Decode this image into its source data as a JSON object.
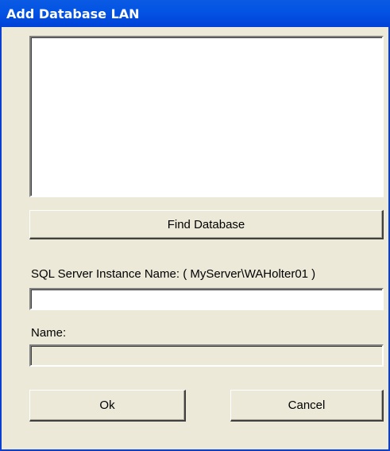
{
  "window": {
    "title": "Add Database LAN"
  },
  "buttons": {
    "find_database": "Find Database",
    "ok": "Ok",
    "cancel": "Cancel"
  },
  "fields": {
    "sql_instance_label": "SQL Server Instance Name: ( MyServer\\WAHolter01 )",
    "sql_instance_value": "",
    "name_label": "Name:",
    "name_value": ""
  },
  "database_list": {
    "items": []
  },
  "colors": {
    "titlebar": "#0054e3",
    "dialog_background": "#ece9d8",
    "input_background": "#ffffff"
  }
}
